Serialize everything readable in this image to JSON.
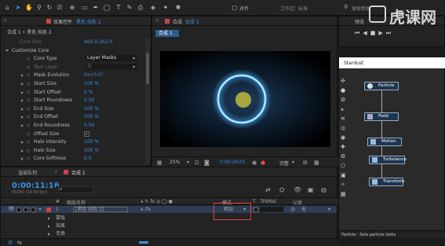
{
  "toolbar": {
    "snap_label": "对齐",
    "workspace_label": "工作区：",
    "workspace_value": "标准",
    "search_placeholder": "搜索帮助"
  },
  "effect_controls": {
    "tab_label": "效果控件",
    "tab_layer": "黑色 纯色 2",
    "header": "合成 1 • 黑色 纯色 2",
    "rows": [
      {
        "label": "Core Size",
        "value": "960.0,162.0",
        "indent": 1,
        "state": "none",
        "dim": true
      },
      {
        "label": "Customize Core",
        "value": "",
        "indent": 0,
        "state": "open"
      },
      {
        "label": "Core Type",
        "value": "Layer Masks",
        "indent": 2,
        "state": "none",
        "dropdown": true
      },
      {
        "label": "Text Layer",
        "value": "无",
        "indent": 2,
        "state": "none",
        "dropdown": true,
        "dim": true
      },
      {
        "label": "Mask Evolution",
        "value": "0x+0.0°",
        "indent": 2,
        "state": "closed"
      },
      {
        "label": "Start Size",
        "value": "100 %",
        "indent": 2,
        "state": "closed"
      },
      {
        "label": "Start Offset",
        "value": "0 %",
        "indent": 2,
        "state": "closed"
      },
      {
        "label": "Start Roundness",
        "value": "0.50",
        "indent": 2,
        "state": "closed"
      },
      {
        "label": "End Size",
        "value": "100 %",
        "indent": 2,
        "state": "closed"
      },
      {
        "label": "End Offset",
        "value": "100 %",
        "indent": 2,
        "state": "closed"
      },
      {
        "label": "End Roundness",
        "value": "0.50",
        "indent": 2,
        "state": "closed"
      },
      {
        "label": "Offset Size",
        "value": "✓",
        "indent": 2,
        "state": "none",
        "check": true
      },
      {
        "label": "Halo Intensity",
        "value": "100 %",
        "indent": 2,
        "state": "closed"
      },
      {
        "label": "Halo Size",
        "value": "100 %",
        "indent": 2,
        "state": "closed"
      },
      {
        "label": "Core Softness",
        "value": "0.0",
        "indent": 2,
        "state": "closed"
      }
    ]
  },
  "composition": {
    "tab_label": "合成",
    "tab_name": "合成 1",
    "subtab": "合成 1",
    "zoom": "25%",
    "timecode": "0:00:29:01",
    "quality": "完整"
  },
  "preview": {
    "tab_label": "预览"
  },
  "stardust": {
    "title": "Stardust",
    "nodes": [
      {
        "label": "Particle"
      },
      {
        "label": "Field"
      },
      {
        "label": "Motion"
      },
      {
        "label": "Turbulence"
      },
      {
        "label": "Transform"
      }
    ],
    "status": "Particle : Sets particle looks"
  },
  "timeline": {
    "tab_render": "渲染队列",
    "tab_comp": "合成 1",
    "timecode": "0:00:11:16",
    "frame_info": "00280 (24.00 fps)",
    "search_placeholder": "ρ▾",
    "col_num": "#",
    "col_name": "图层名称",
    "col_mode": "模式",
    "col_t": "T",
    "col_trkmat": "TrkMat",
    "col_parent": "父级",
    "layer_num": "1",
    "layer_name": "[黑色 纯色 2]",
    "layer_mode": "相加",
    "layer_parent": "无",
    "sub1": "蒙版",
    "sub2": "效果",
    "sub3": "变换"
  },
  "watermark": {
    "text": "虎课网"
  },
  "colors": {
    "accent": "#3a8fe0",
    "ring": "#6fc6ff",
    "highlight_box": "#e04040"
  }
}
